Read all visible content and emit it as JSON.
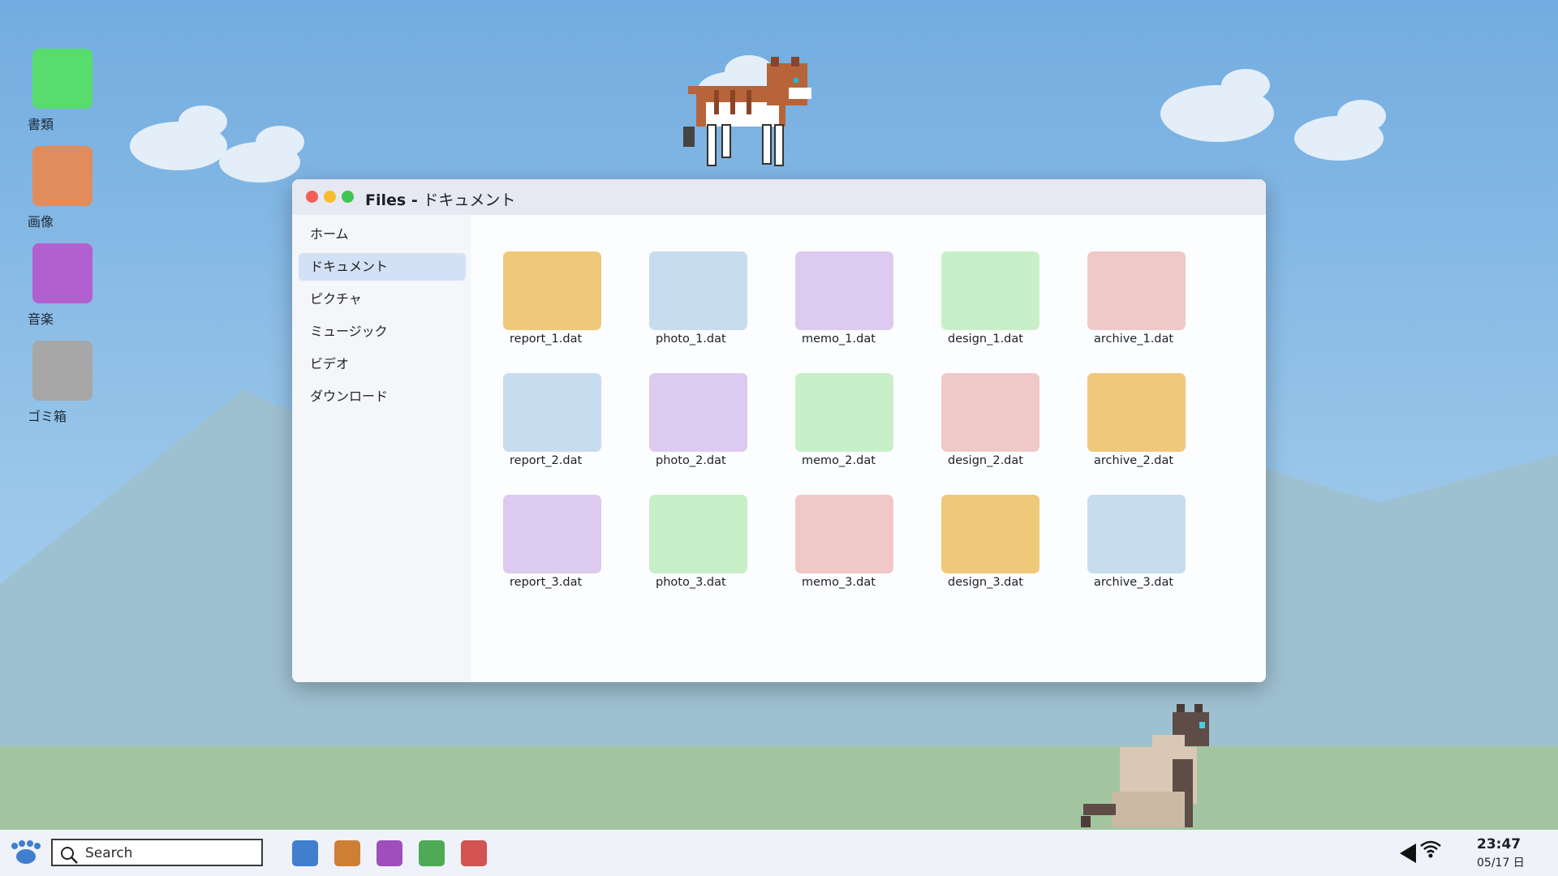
{
  "desktop": {
    "icons": [
      {
        "label": "書類",
        "color": "#58dd6d"
      },
      {
        "label": "画像",
        "color": "#e08c5d"
      },
      {
        "label": "音楽",
        "color": "#b25fcf"
      },
      {
        "label": "ゴミ箱",
        "color": "#a7a7a7"
      }
    ]
  },
  "window": {
    "title_bold": "Files - ",
    "title_rest": "ドキュメント",
    "sidebar": {
      "items": [
        "ホーム",
        "ドキュメント",
        "ピクチャ",
        "ミュージック",
        "ビデオ",
        "ダウンロード"
      ],
      "active": "ドキュメント"
    },
    "files": [
      {
        "name": "report_1.dat",
        "color": "#f0c87a"
      },
      {
        "name": "photo_1.dat",
        "color": "#c8dcf0"
      },
      {
        "name": "memo_1.dat",
        "color": "#dccaf0"
      },
      {
        "name": "design_1.dat",
        "color": "#c8f0c8"
      },
      {
        "name": "archive_1.dat",
        "color": "#f0c8c8"
      },
      {
        "name": "report_2.dat",
        "color": "#c8dcf0"
      },
      {
        "name": "photo_2.dat",
        "color": "#dccaf0"
      },
      {
        "name": "memo_2.dat",
        "color": "#c8f0c8"
      },
      {
        "name": "design_2.dat",
        "color": "#f0c8c8"
      },
      {
        "name": "archive_2.dat",
        "color": "#f0c87a"
      },
      {
        "name": "report_3.dat",
        "color": "#dccaf0"
      },
      {
        "name": "photo_3.dat",
        "color": "#c8f0c8"
      },
      {
        "name": "memo_3.dat",
        "color": "#f0c8c8"
      },
      {
        "name": "design_3.dat",
        "color": "#f0c87a"
      },
      {
        "name": "archive_3.dat",
        "color": "#c8dcf0"
      }
    ]
  },
  "taskbar": {
    "search_placeholder": "Search",
    "apps": [
      "#3f7fcd",
      "#cd7f35",
      "#9f4fbd",
      "#4faa55",
      "#d35252"
    ],
    "time": "23:47",
    "date": "05/17 日"
  }
}
